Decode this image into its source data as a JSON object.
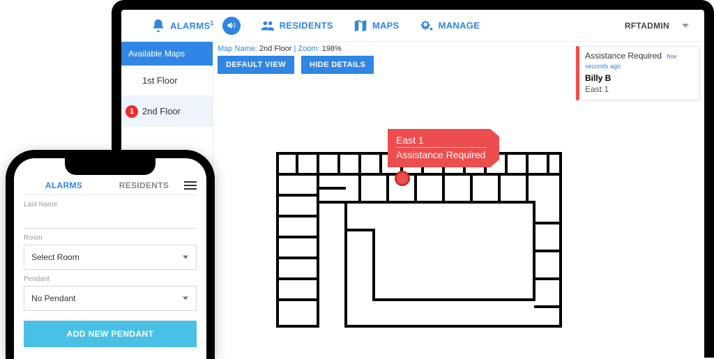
{
  "nav": {
    "alarms": "ALARMS",
    "alarms_count": "1",
    "residents": "RESIDENTS",
    "maps": "MAPS",
    "manage": "MANAGE",
    "user": "RFTADMIN"
  },
  "sidebar": {
    "header": "Available Maps",
    "items": [
      {
        "label": "1st Floor"
      },
      {
        "label": "2nd Floor",
        "badge": "1"
      }
    ]
  },
  "map": {
    "name_label": "Map Name:",
    "name_value": "2nd Floor",
    "zoom_label": "Zoom:",
    "zoom_value": "198%",
    "btn_default": "DEFAULT VIEW",
    "btn_hide": "HIDE DETAILS",
    "callout_location": "East 1",
    "callout_status": "Assistance Required"
  },
  "alert": {
    "title": "Assistance Required",
    "ago": "few seconds ago",
    "who": "Billy B",
    "where": "East 1"
  },
  "phone": {
    "tab_alarms": "ALARMS",
    "tab_residents": "RESIDENTS",
    "lbl_lastname": "Last Name",
    "lbl_room": "Room",
    "select_room": "Select Room",
    "lbl_pendant": "Pendant",
    "select_pendant": "No Pendant",
    "btn_add": "ADD NEW PENDANT"
  }
}
